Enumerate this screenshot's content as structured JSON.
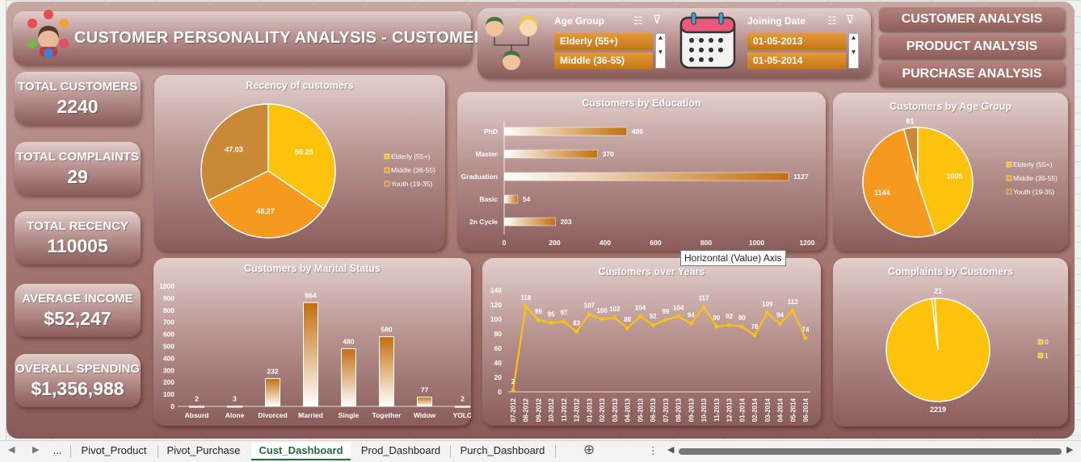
{
  "title": "CUSTOMER PERSONALITY ANALYSIS - CUSTOMER",
  "kpis": [
    {
      "label": "TOTAL CUSTOMERS",
      "value": "2240"
    },
    {
      "label": "TOTAL COMPLAINTS",
      "value": "29"
    },
    {
      "label": "TOTAL RECENCY",
      "value": "110005"
    },
    {
      "label": "AVERAGE INCOME",
      "value": "$52,247"
    },
    {
      "label": "OVERALL SPENDING",
      "value": "$1,356,988"
    }
  ],
  "slicers": {
    "age_group": {
      "header": "Age Group",
      "items": [
        "Elderly (55+)",
        "Middle (36-55)"
      ]
    },
    "joining_date": {
      "header": "Joining Date",
      "items": [
        "01-05-2013",
        "01-05-2014"
      ]
    }
  },
  "nav": [
    "CUSTOMER ANALYSIS",
    "PRODUCT ANALYSIS",
    "PURCHASE ANALYSIS"
  ],
  "tooltip": "Horizontal (Value) Axis",
  "tabs": [
    "...",
    "Pivot_Product",
    "Pivot_Purchase",
    "Cust_Dashboard",
    "Prod_Dashboard",
    "Purch_Dashboard"
  ],
  "active_tab": "Cust_Dashboard",
  "colors": {
    "yellow": "#fcc20c",
    "orange": "#f59a1e",
    "brown": "#c98a38",
    "bar": "#c2700f"
  },
  "chart_data": [
    {
      "id": "recency",
      "type": "pie",
      "title": "Recency of customers",
      "labels": [
        "Elderly (55+)",
        "Middle (36-55)",
        "Youth (19-35)"
      ],
      "values": [
        50.25,
        48.27,
        47.03
      ],
      "legend": "right"
    },
    {
      "id": "education",
      "type": "bar",
      "orientation": "horizontal",
      "title": "Customers by Education",
      "categories": [
        "PhD",
        "Master",
        "Graduation",
        "Basic",
        "2n Cycle"
      ],
      "values": [
        486,
        370,
        1127,
        54,
        203
      ],
      "xlim": [
        0,
        1200
      ],
      "ticks": [
        "0",
        "200",
        "400",
        "600",
        "800",
        "1000",
        "1200"
      ]
    },
    {
      "id": "age",
      "type": "pie",
      "title": "Customers by Age Group",
      "labels": [
        "Elderly (55+)",
        "Middle (36-55)",
        "Youth (19-35)"
      ],
      "values": [
        1005,
        1144,
        91
      ],
      "legend": "right"
    },
    {
      "id": "marital",
      "type": "bar",
      "title": "Customers by Marital Status",
      "categories": [
        "Absurd",
        "Alone",
        "Divorced",
        "Married",
        "Single",
        "Together",
        "Widow",
        "YOLO"
      ],
      "values": [
        2,
        3,
        232,
        864,
        480,
        580,
        77,
        2
      ],
      "ylim": [
        0,
        1000
      ],
      "ticks": [
        "0",
        "100",
        "200",
        "300",
        "400",
        "500",
        "600",
        "700",
        "800",
        "900",
        "1000"
      ]
    },
    {
      "id": "years",
      "type": "line",
      "title": "Customers over Years",
      "x": [
        "07-2012",
        "08-2012",
        "09-2012",
        "10-2012",
        "11-2012",
        "12-2012",
        "01-2013",
        "02-2013",
        "03-2013",
        "04-2013",
        "05-2013",
        "06-2013",
        "07-2013",
        "08-2013",
        "09-2013",
        "10-2013",
        "11-2013",
        "12-2013",
        "01-2014",
        "02-2014",
        "03-2014",
        "04-2014",
        "05-2014",
        "06-2014"
      ],
      "values": [
        2,
        118,
        99,
        95,
        97,
        83,
        107,
        100,
        102,
        88,
        104,
        92,
        99,
        104,
        94,
        117,
        90,
        92,
        90,
        78,
        109,
        94,
        112,
        74
      ],
      "ylim": [
        0,
        140
      ],
      "ticks": [
        "0",
        "20",
        "40",
        "60",
        "80",
        "100",
        "120",
        "140"
      ]
    },
    {
      "id": "complaints",
      "type": "pie",
      "title": "Complaints by Customers",
      "labels": [
        "0",
        "1"
      ],
      "values": [
        2219,
        21
      ],
      "legend": "right"
    }
  ]
}
